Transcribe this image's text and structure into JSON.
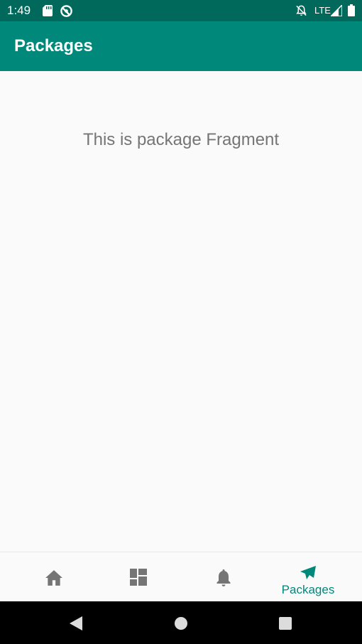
{
  "status_bar": {
    "time": "1:49",
    "network": "LTE",
    "icons": [
      "sd-card-icon",
      "sync-icon",
      "bell-off-icon",
      "signal-icon",
      "battery-icon"
    ]
  },
  "app_bar": {
    "title": "Packages"
  },
  "content": {
    "message": "This is package Fragment"
  },
  "bottom_nav": {
    "items": [
      {
        "icon": "home-icon",
        "label": "",
        "selected": false
      },
      {
        "icon": "dashboard-icon",
        "label": "",
        "selected": false
      },
      {
        "icon": "bell-icon",
        "label": "",
        "selected": false
      },
      {
        "icon": "send-icon",
        "label": "Packages",
        "selected": true
      }
    ]
  },
  "system_nav": {
    "icons": [
      "back-icon",
      "home-circle-icon",
      "recents-icon"
    ]
  },
  "colors": {
    "status_bar": "#00695c",
    "app_bar": "#00897b",
    "accent": "#00897b",
    "inactive_icon": "#757575",
    "background": "#fafafa"
  }
}
